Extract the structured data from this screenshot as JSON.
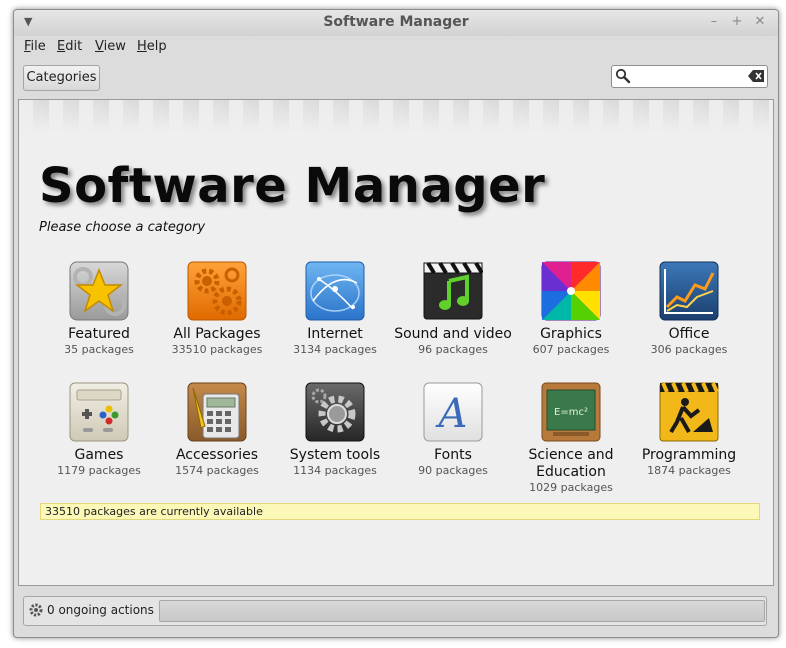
{
  "window": {
    "title": "Software Manager"
  },
  "menu": [
    {
      "label": "File",
      "mnemonic": "F",
      "rest": "ile"
    },
    {
      "label": "Edit",
      "mnemonic": "E",
      "rest": "dit"
    },
    {
      "label": "View",
      "mnemonic": "V",
      "rest": "iew"
    },
    {
      "label": "Help",
      "mnemonic": "H",
      "rest": "elp"
    }
  ],
  "toolbar": {
    "categories_label": "Categories"
  },
  "search": {
    "value": "",
    "placeholder": ""
  },
  "main": {
    "title": "Software Manager",
    "subtitle": "Please choose a category",
    "categories": [
      {
        "name": "Featured",
        "count": "35 packages",
        "icon": "star-icon"
      },
      {
        "name": "All Packages",
        "count": "33510 packages",
        "icon": "gears-icon"
      },
      {
        "name": "Internet",
        "count": "3134 packages",
        "icon": "globe-network-icon"
      },
      {
        "name": "Sound and video",
        "count": "96 packages",
        "icon": "clapperboard-music-icon"
      },
      {
        "name": "Graphics",
        "count": "607 packages",
        "icon": "color-wheel-icon"
      },
      {
        "name": "Office",
        "count": "306 packages",
        "icon": "chart-icon"
      },
      {
        "name": "Games",
        "count": "1179 packages",
        "icon": "gamepad-icon"
      },
      {
        "name": "Accessories",
        "count": "1574 packages",
        "icon": "calculator-icon"
      },
      {
        "name": "System tools",
        "count": "1134 packages",
        "icon": "system-gear-icon"
      },
      {
        "name": "Fonts",
        "count": "90 packages",
        "icon": "font-icon"
      },
      {
        "name": "Science and Education",
        "count": "1029 packages",
        "icon": "chalkboard-icon"
      },
      {
        "name": "Programming",
        "count": "1874 packages",
        "icon": "construction-sign-icon"
      }
    ],
    "info": "33510 packages are currently available"
  },
  "status": {
    "text": "0 ongoing actions",
    "progress": 0
  },
  "colors": {
    "info_background": "#fcf8b8",
    "title_text": "#0a0a0a"
  }
}
